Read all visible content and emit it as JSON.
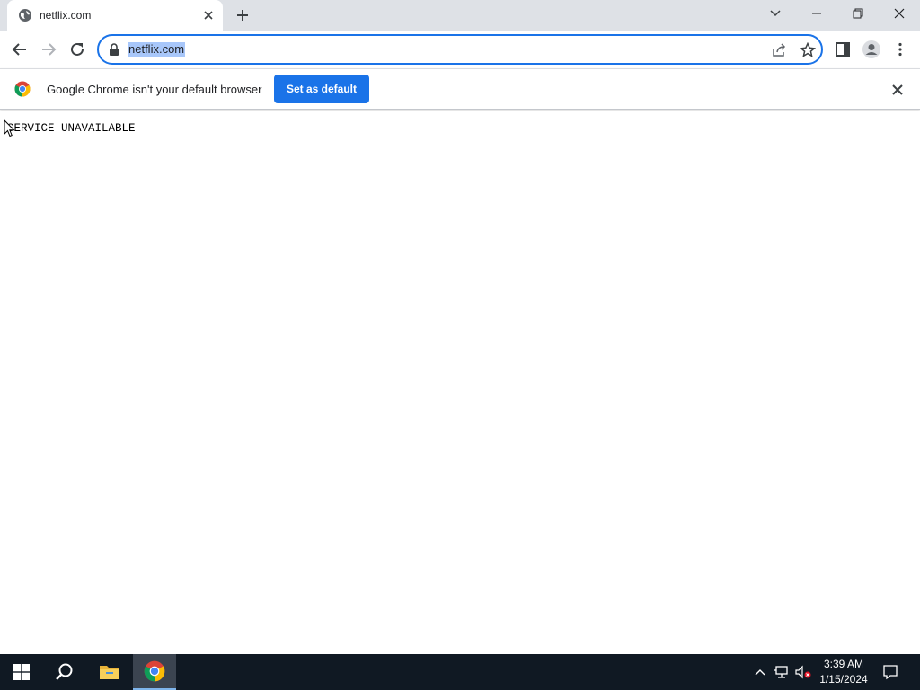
{
  "browser": {
    "tab": {
      "title": "netflix.com"
    },
    "address_bar": {
      "url": "netflix.com"
    }
  },
  "infobar": {
    "message": "Google Chrome isn't your default browser",
    "button_label": "Set as default"
  },
  "page": {
    "body_text": "SERVICE UNAVAILABLE"
  },
  "taskbar": {
    "clock": {
      "time": "3:39 AM",
      "date": "1/15/2024"
    }
  },
  "colors": {
    "accent": "#1a73e8",
    "tabstrip": "#dee1e6",
    "taskbar": "#101923",
    "url_highlight": "#a8c7fa"
  }
}
